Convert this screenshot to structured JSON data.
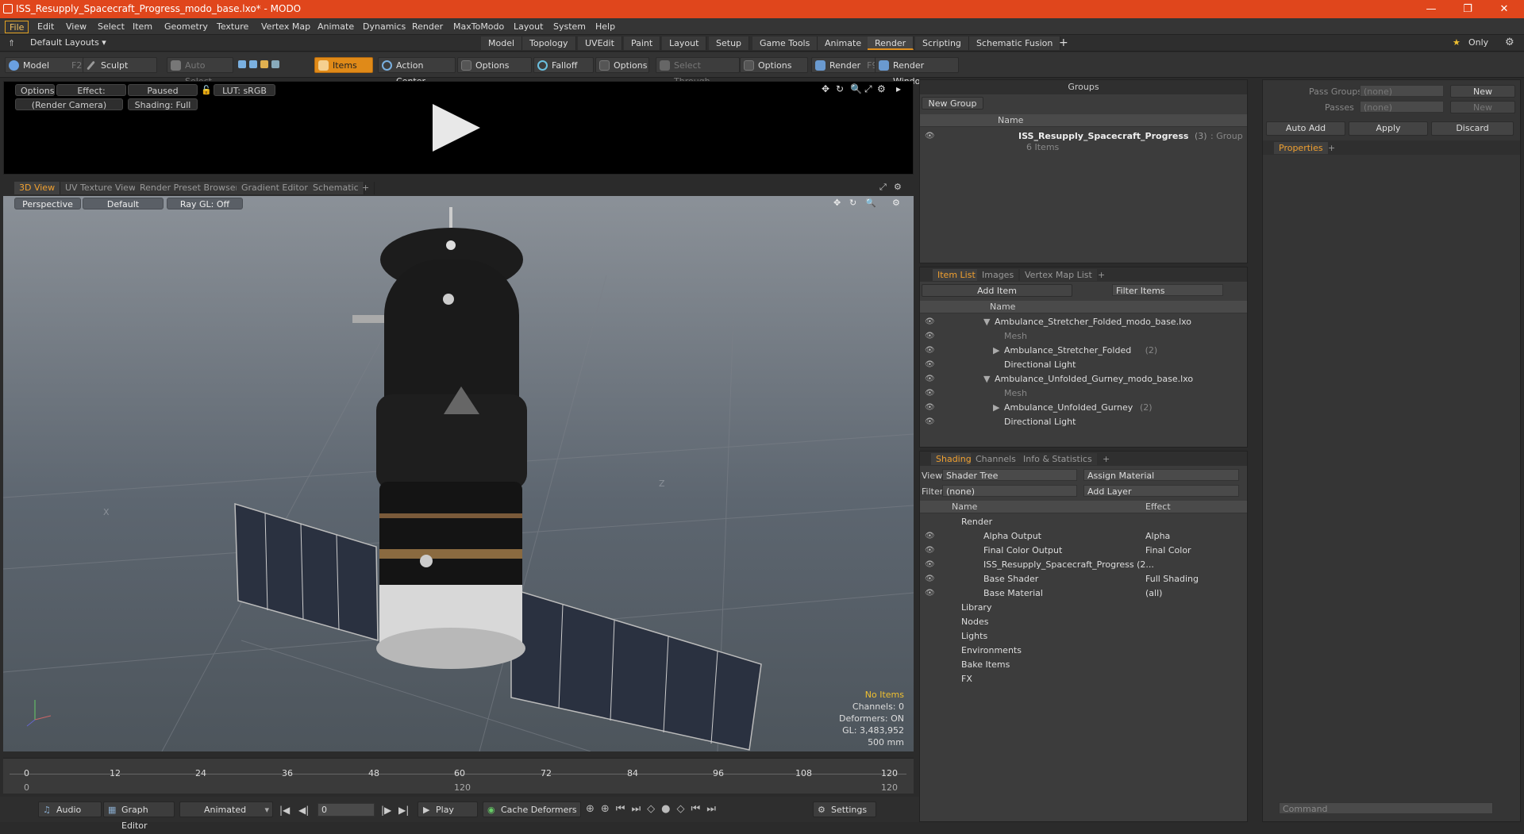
{
  "window": {
    "title": "ISS_Resupply_Spacecraft_Progress_modo_base.lxo* - MODO",
    "min": "—",
    "max": "❐",
    "close": "✕"
  },
  "menu": [
    "File",
    "Edit",
    "View",
    "Select",
    "Item",
    "Geometry",
    "Texture",
    "Vertex Map",
    "Animate",
    "Dynamics",
    "Render",
    "MaxToModo",
    "Layout",
    "System",
    "Help"
  ],
  "layouts": {
    "label": "Default Layouts ▾",
    "tabs": [
      "Model",
      "Topology",
      "UVEdit",
      "Paint",
      "Layout",
      "Setup",
      "Game Tools",
      "Animate",
      "Render",
      "Scripting",
      "Schematic Fusion"
    ],
    "active": "Render",
    "plus": "+",
    "only": "Only"
  },
  "toolbar": {
    "model": "Model",
    "model_key": "F2",
    "sculpt": "Sculpt",
    "auto_select": "Auto Select",
    "items": "Items",
    "action_center": "Action Center",
    "options1": "Options",
    "falloff": "Falloff",
    "options2": "Options",
    "select_through": "Select Through",
    "options3": "Options",
    "render": "Render",
    "render_key": "F9",
    "render_window": "Render Window"
  },
  "preview": {
    "options": "Options",
    "effect": "Effect: (Shadi...",
    "paused": "Paused",
    "lut": "LUT: sRGB",
    "camera": "(Render Camera)",
    "shading": "Shading: Full"
  },
  "viewtabs": [
    "3D View",
    "UV Texture View",
    "Render Preset Browser",
    "Gradient Editor",
    "Schematic",
    "+"
  ],
  "viewport": {
    "perspective": "Perspective",
    "default": "Default",
    "raygl": "Ray GL: Off",
    "axis_x": "X",
    "axis_z": "Z"
  },
  "stats": {
    "no_items": "No Items",
    "channels": "Channels: 0",
    "deformers": "Deformers: ON",
    "gl": "GL: 3,483,952",
    "scale": "500 mm"
  },
  "timeline": {
    "ticks": [
      "0",
      "12",
      "24",
      "36",
      "48",
      "60",
      "72",
      "84",
      "96",
      "108",
      "120"
    ],
    "low": [
      "0",
      "120",
      "120"
    ]
  },
  "bottom": {
    "audio": "Audio",
    "graph": "Graph Editor",
    "animated": "Animated",
    "frame": "0",
    "play": "Play",
    "cache": "Cache Deformers",
    "settings": "Settings"
  },
  "groups": {
    "title": "Groups",
    "new_group": "New Group",
    "col_name": "Name",
    "item_name": "ISS_Resupply_Spacecraft_Progress",
    "item_count": "(3)",
    "item_type": ": Group",
    "item_sub": "6 Items"
  },
  "itemlist": {
    "tabs": [
      "Item List",
      "Images",
      "Vertex Map List",
      "+"
    ],
    "add_item": "Add Item",
    "filter": "Filter Items",
    "col_name": "Name",
    "rows": [
      {
        "label": "Ambulance_Stretcher_Folded_modo_base.lxo",
        "indent": 0,
        "arrow": "▼",
        "muted": false,
        "count": ""
      },
      {
        "label": "Mesh",
        "indent": 1,
        "arrow": "",
        "muted": true,
        "count": ""
      },
      {
        "label": "Ambulance_Stretcher_Folded",
        "indent": 1,
        "arrow": "▶",
        "muted": false,
        "count": "(2)"
      },
      {
        "label": "Directional Light",
        "indent": 1,
        "arrow": "",
        "muted": false,
        "count": ""
      },
      {
        "label": "Ambulance_Unfolded_Gurney_modo_base.lxo",
        "indent": 0,
        "arrow": "▼",
        "muted": false,
        "count": ""
      },
      {
        "label": "Mesh",
        "indent": 1,
        "arrow": "",
        "muted": true,
        "count": ""
      },
      {
        "label": "Ambulance_Unfolded_Gurney",
        "indent": 1,
        "arrow": "▶",
        "muted": false,
        "count": "(2)"
      },
      {
        "label": "Directional Light",
        "indent": 1,
        "arrow": "",
        "muted": false,
        "count": ""
      }
    ]
  },
  "shading": {
    "tabs": [
      "Shading",
      "Channels",
      "Info & Statistics",
      "+"
    ],
    "view_label": "View",
    "view_val": "Shader Tree",
    "assign": "Assign Material",
    "filter_label": "Filter",
    "filter_val": "(none)",
    "add_layer": "Add Layer",
    "col_name": "Name",
    "col_effect": "Effect",
    "rows": [
      {
        "label": "Render",
        "effect": "",
        "indent": 0
      },
      {
        "label": "Alpha Output",
        "effect": "Alpha",
        "indent": 1
      },
      {
        "label": "Final Color Output",
        "effect": "Final Color",
        "indent": 1
      },
      {
        "label": "ISS_Resupply_Spacecraft_Progress (2...",
        "effect": "",
        "indent": 1
      },
      {
        "label": "Base Shader",
        "effect": "Full Shading",
        "indent": 1
      },
      {
        "label": "Base Material",
        "effect": "(all)",
        "indent": 1
      },
      {
        "label": "Library",
        "effect": "",
        "indent": 0
      },
      {
        "label": "Nodes",
        "effect": "",
        "indent": 0
      },
      {
        "label": "Lights",
        "effect": "",
        "indent": 0
      },
      {
        "label": "Environments",
        "effect": "",
        "indent": 0
      },
      {
        "label": "Bake Items",
        "effect": "",
        "indent": 0
      },
      {
        "label": "FX",
        "effect": "",
        "indent": 0
      }
    ]
  },
  "props": {
    "pass_groups": "Pass Groups",
    "passes": "Passes",
    "none": "(none)",
    "new": "New",
    "auto_add": "Auto Add",
    "apply": "Apply",
    "discard": "Discard",
    "properties": "Properties",
    "plus": "+",
    "command": "Command"
  }
}
